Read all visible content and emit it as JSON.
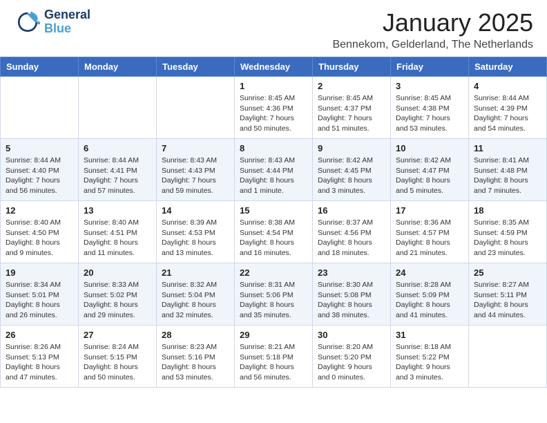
{
  "header": {
    "logo": {
      "general": "General",
      "blue": "Blue"
    },
    "title": "January 2025",
    "location": "Bennekom, Gelderland, The Netherlands"
  },
  "calendar": {
    "weekdays": [
      "Sunday",
      "Monday",
      "Tuesday",
      "Wednesday",
      "Thursday",
      "Friday",
      "Saturday"
    ],
    "weeks": [
      [
        {
          "day": "",
          "text": ""
        },
        {
          "day": "",
          "text": ""
        },
        {
          "day": "",
          "text": ""
        },
        {
          "day": "1",
          "text": "Sunrise: 8:45 AM\nSunset: 4:36 PM\nDaylight: 7 hours\nand 50 minutes."
        },
        {
          "day": "2",
          "text": "Sunrise: 8:45 AM\nSunset: 4:37 PM\nDaylight: 7 hours\nand 51 minutes."
        },
        {
          "day": "3",
          "text": "Sunrise: 8:45 AM\nSunset: 4:38 PM\nDaylight: 7 hours\nand 53 minutes."
        },
        {
          "day": "4",
          "text": "Sunrise: 8:44 AM\nSunset: 4:39 PM\nDaylight: 7 hours\nand 54 minutes."
        }
      ],
      [
        {
          "day": "5",
          "text": "Sunrise: 8:44 AM\nSunset: 4:40 PM\nDaylight: 7 hours\nand 56 minutes."
        },
        {
          "day": "6",
          "text": "Sunrise: 8:44 AM\nSunset: 4:41 PM\nDaylight: 7 hours\nand 57 minutes."
        },
        {
          "day": "7",
          "text": "Sunrise: 8:43 AM\nSunset: 4:43 PM\nDaylight: 7 hours\nand 59 minutes."
        },
        {
          "day": "8",
          "text": "Sunrise: 8:43 AM\nSunset: 4:44 PM\nDaylight: 8 hours\nand 1 minute."
        },
        {
          "day": "9",
          "text": "Sunrise: 8:42 AM\nSunset: 4:45 PM\nDaylight: 8 hours\nand 3 minutes."
        },
        {
          "day": "10",
          "text": "Sunrise: 8:42 AM\nSunset: 4:47 PM\nDaylight: 8 hours\nand 5 minutes."
        },
        {
          "day": "11",
          "text": "Sunrise: 8:41 AM\nSunset: 4:48 PM\nDaylight: 8 hours\nand 7 minutes."
        }
      ],
      [
        {
          "day": "12",
          "text": "Sunrise: 8:40 AM\nSunset: 4:50 PM\nDaylight: 8 hours\nand 9 minutes."
        },
        {
          "day": "13",
          "text": "Sunrise: 8:40 AM\nSunset: 4:51 PM\nDaylight: 8 hours\nand 11 minutes."
        },
        {
          "day": "14",
          "text": "Sunrise: 8:39 AM\nSunset: 4:53 PM\nDaylight: 8 hours\nand 13 minutes."
        },
        {
          "day": "15",
          "text": "Sunrise: 8:38 AM\nSunset: 4:54 PM\nDaylight: 8 hours\nand 16 minutes."
        },
        {
          "day": "16",
          "text": "Sunrise: 8:37 AM\nSunset: 4:56 PM\nDaylight: 8 hours\nand 18 minutes."
        },
        {
          "day": "17",
          "text": "Sunrise: 8:36 AM\nSunset: 4:57 PM\nDaylight: 8 hours\nand 21 minutes."
        },
        {
          "day": "18",
          "text": "Sunrise: 8:35 AM\nSunset: 4:59 PM\nDaylight: 8 hours\nand 23 minutes."
        }
      ],
      [
        {
          "day": "19",
          "text": "Sunrise: 8:34 AM\nSunset: 5:01 PM\nDaylight: 8 hours\nand 26 minutes."
        },
        {
          "day": "20",
          "text": "Sunrise: 8:33 AM\nSunset: 5:02 PM\nDaylight: 8 hours\nand 29 minutes."
        },
        {
          "day": "21",
          "text": "Sunrise: 8:32 AM\nSunset: 5:04 PM\nDaylight: 8 hours\nand 32 minutes."
        },
        {
          "day": "22",
          "text": "Sunrise: 8:31 AM\nSunset: 5:06 PM\nDaylight: 8 hours\nand 35 minutes."
        },
        {
          "day": "23",
          "text": "Sunrise: 8:30 AM\nSunset: 5:08 PM\nDaylight: 8 hours\nand 38 minutes."
        },
        {
          "day": "24",
          "text": "Sunrise: 8:28 AM\nSunset: 5:09 PM\nDaylight: 8 hours\nand 41 minutes."
        },
        {
          "day": "25",
          "text": "Sunrise: 8:27 AM\nSunset: 5:11 PM\nDaylight: 8 hours\nand 44 minutes."
        }
      ],
      [
        {
          "day": "26",
          "text": "Sunrise: 8:26 AM\nSunset: 5:13 PM\nDaylight: 8 hours\nand 47 minutes."
        },
        {
          "day": "27",
          "text": "Sunrise: 8:24 AM\nSunset: 5:15 PM\nDaylight: 8 hours\nand 50 minutes."
        },
        {
          "day": "28",
          "text": "Sunrise: 8:23 AM\nSunset: 5:16 PM\nDaylight: 8 hours\nand 53 minutes."
        },
        {
          "day": "29",
          "text": "Sunrise: 8:21 AM\nSunset: 5:18 PM\nDaylight: 8 hours\nand 56 minutes."
        },
        {
          "day": "30",
          "text": "Sunrise: 8:20 AM\nSunset: 5:20 PM\nDaylight: 9 hours\nand 0 minutes."
        },
        {
          "day": "31",
          "text": "Sunrise: 8:18 AM\nSunset: 5:22 PM\nDaylight: 9 hours\nand 3 minutes."
        },
        {
          "day": "",
          "text": ""
        }
      ]
    ]
  }
}
